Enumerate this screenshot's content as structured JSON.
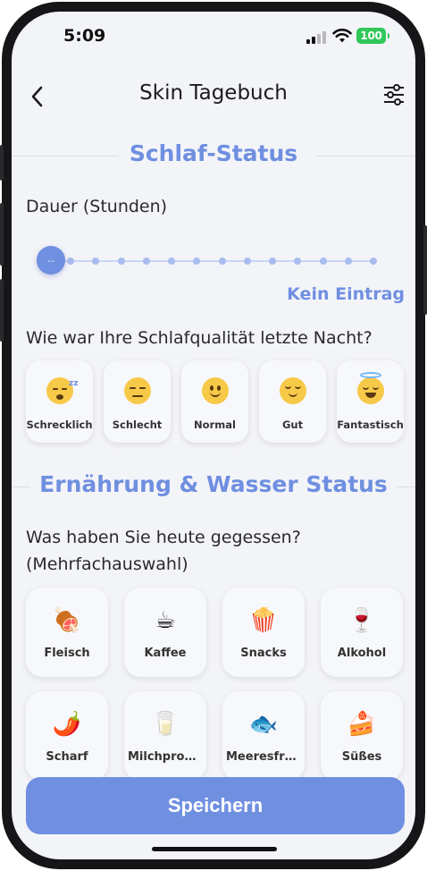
{
  "status_bar": {
    "time": "5:09",
    "battery": "100"
  },
  "header": {
    "title": "Skin Tagebuch"
  },
  "sleep": {
    "section_title": "Schlaf-Status",
    "duration_label": "Dauer (Stunden)",
    "slider_value": "--",
    "slider_steps": 13,
    "no_entry": "Kein Eintrag",
    "quality_question": "Wie war Ihre Schlafqualität letzte Nacht?",
    "moods": [
      {
        "label": "Schrecklich",
        "icon": "sleepy-face-icon"
      },
      {
        "label": "Schlecht",
        "icon": "expressionless-face-icon"
      },
      {
        "label": "Normal",
        "icon": "slightly-smiling-face-icon"
      },
      {
        "label": "Gut",
        "icon": "relieved-face-icon"
      },
      {
        "label": "Fantastisch",
        "icon": "halo-face-icon"
      }
    ]
  },
  "nutrition": {
    "section_title": "Ernährung & Wasser Status",
    "question_line1": "Was haben Sie heute gegessen?",
    "question_line2": "(Mehrfachauswahl)",
    "foods": [
      {
        "label": "Fleisch",
        "icon": "meat-icon",
        "glyph": "🍖"
      },
      {
        "label": "Kaffee",
        "icon": "coffee-icon",
        "glyph": "☕"
      },
      {
        "label": "Snacks",
        "icon": "popcorn-icon",
        "glyph": "🍿"
      },
      {
        "label": "Alkohol",
        "icon": "wine-icon",
        "glyph": "🍷"
      },
      {
        "label": "Scharf",
        "icon": "chili-icon",
        "glyph": "🌶️"
      },
      {
        "label": "Milchprodu···",
        "icon": "milk-icon",
        "glyph": "🥛"
      },
      {
        "label": "Meeresfrüc···",
        "icon": "fish-icon",
        "glyph": "🐟"
      },
      {
        "label": "Süßes",
        "icon": "cake-icon",
        "glyph": "🍰"
      }
    ]
  },
  "save_button": "Speichern",
  "colors": {
    "accent": "#6f8fe0",
    "background": "#f3f4f8",
    "battery": "#31c759"
  }
}
